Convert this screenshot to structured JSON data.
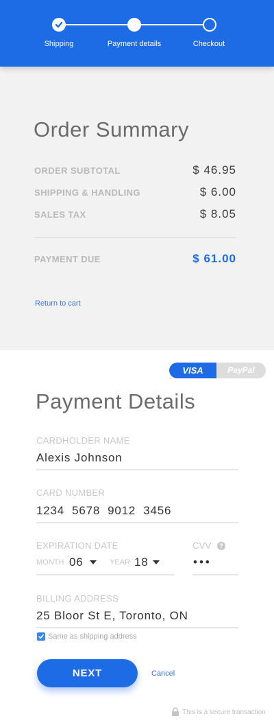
{
  "stepper": {
    "steps": [
      {
        "label": "Shipping",
        "state": "done"
      },
      {
        "label": "Payment details",
        "state": "active"
      },
      {
        "label": "Checkout",
        "state": "todo"
      }
    ],
    "color": "#1e6be6"
  },
  "summary": {
    "title": "Order Summary",
    "rows": [
      {
        "label": "ORDER SUBTOTAL",
        "value": "$ 46.95"
      },
      {
        "label": "SHIPPING & HANDLING",
        "value": "$ 6.00"
      },
      {
        "label": "SALES TAX",
        "value": "$ 8.05"
      }
    ],
    "due": {
      "label": "PAYMENT DUE",
      "value": "$ 61.00"
    },
    "return_link": "Return to cart"
  },
  "payment": {
    "method_toggle": {
      "visa": "VISA",
      "paypal": "PayPal",
      "selected": "VISA"
    },
    "title": "Payment Details",
    "cardholder": {
      "label": "CARDHOLDER NAME",
      "value": "Alexis Johnson"
    },
    "card_number": {
      "label": "CARD NUMBER",
      "value": "1234  5678  9012  3456"
    },
    "expiration": {
      "label": "EXPIRATION DATE",
      "month_label": "MONTH",
      "month_value": "06",
      "year_label": "YEAR",
      "year_value": "18"
    },
    "cvv": {
      "label": "CVV",
      "value": "•••",
      "help_icon": "?"
    },
    "billing": {
      "label": "BILLING ADDRESS",
      "value": "25 Bloor St E, Toronto, ON"
    },
    "same_as_shipping": {
      "label": "Same as shipping address",
      "checked": true
    },
    "next_label": "NEXT",
    "cancel_label": "Cancel",
    "secure_text": "This is a secure transaction"
  },
  "colors": {
    "accent": "#1e6be6",
    "link": "#3e73e6",
    "summary_bg": "#f2f2f2"
  }
}
